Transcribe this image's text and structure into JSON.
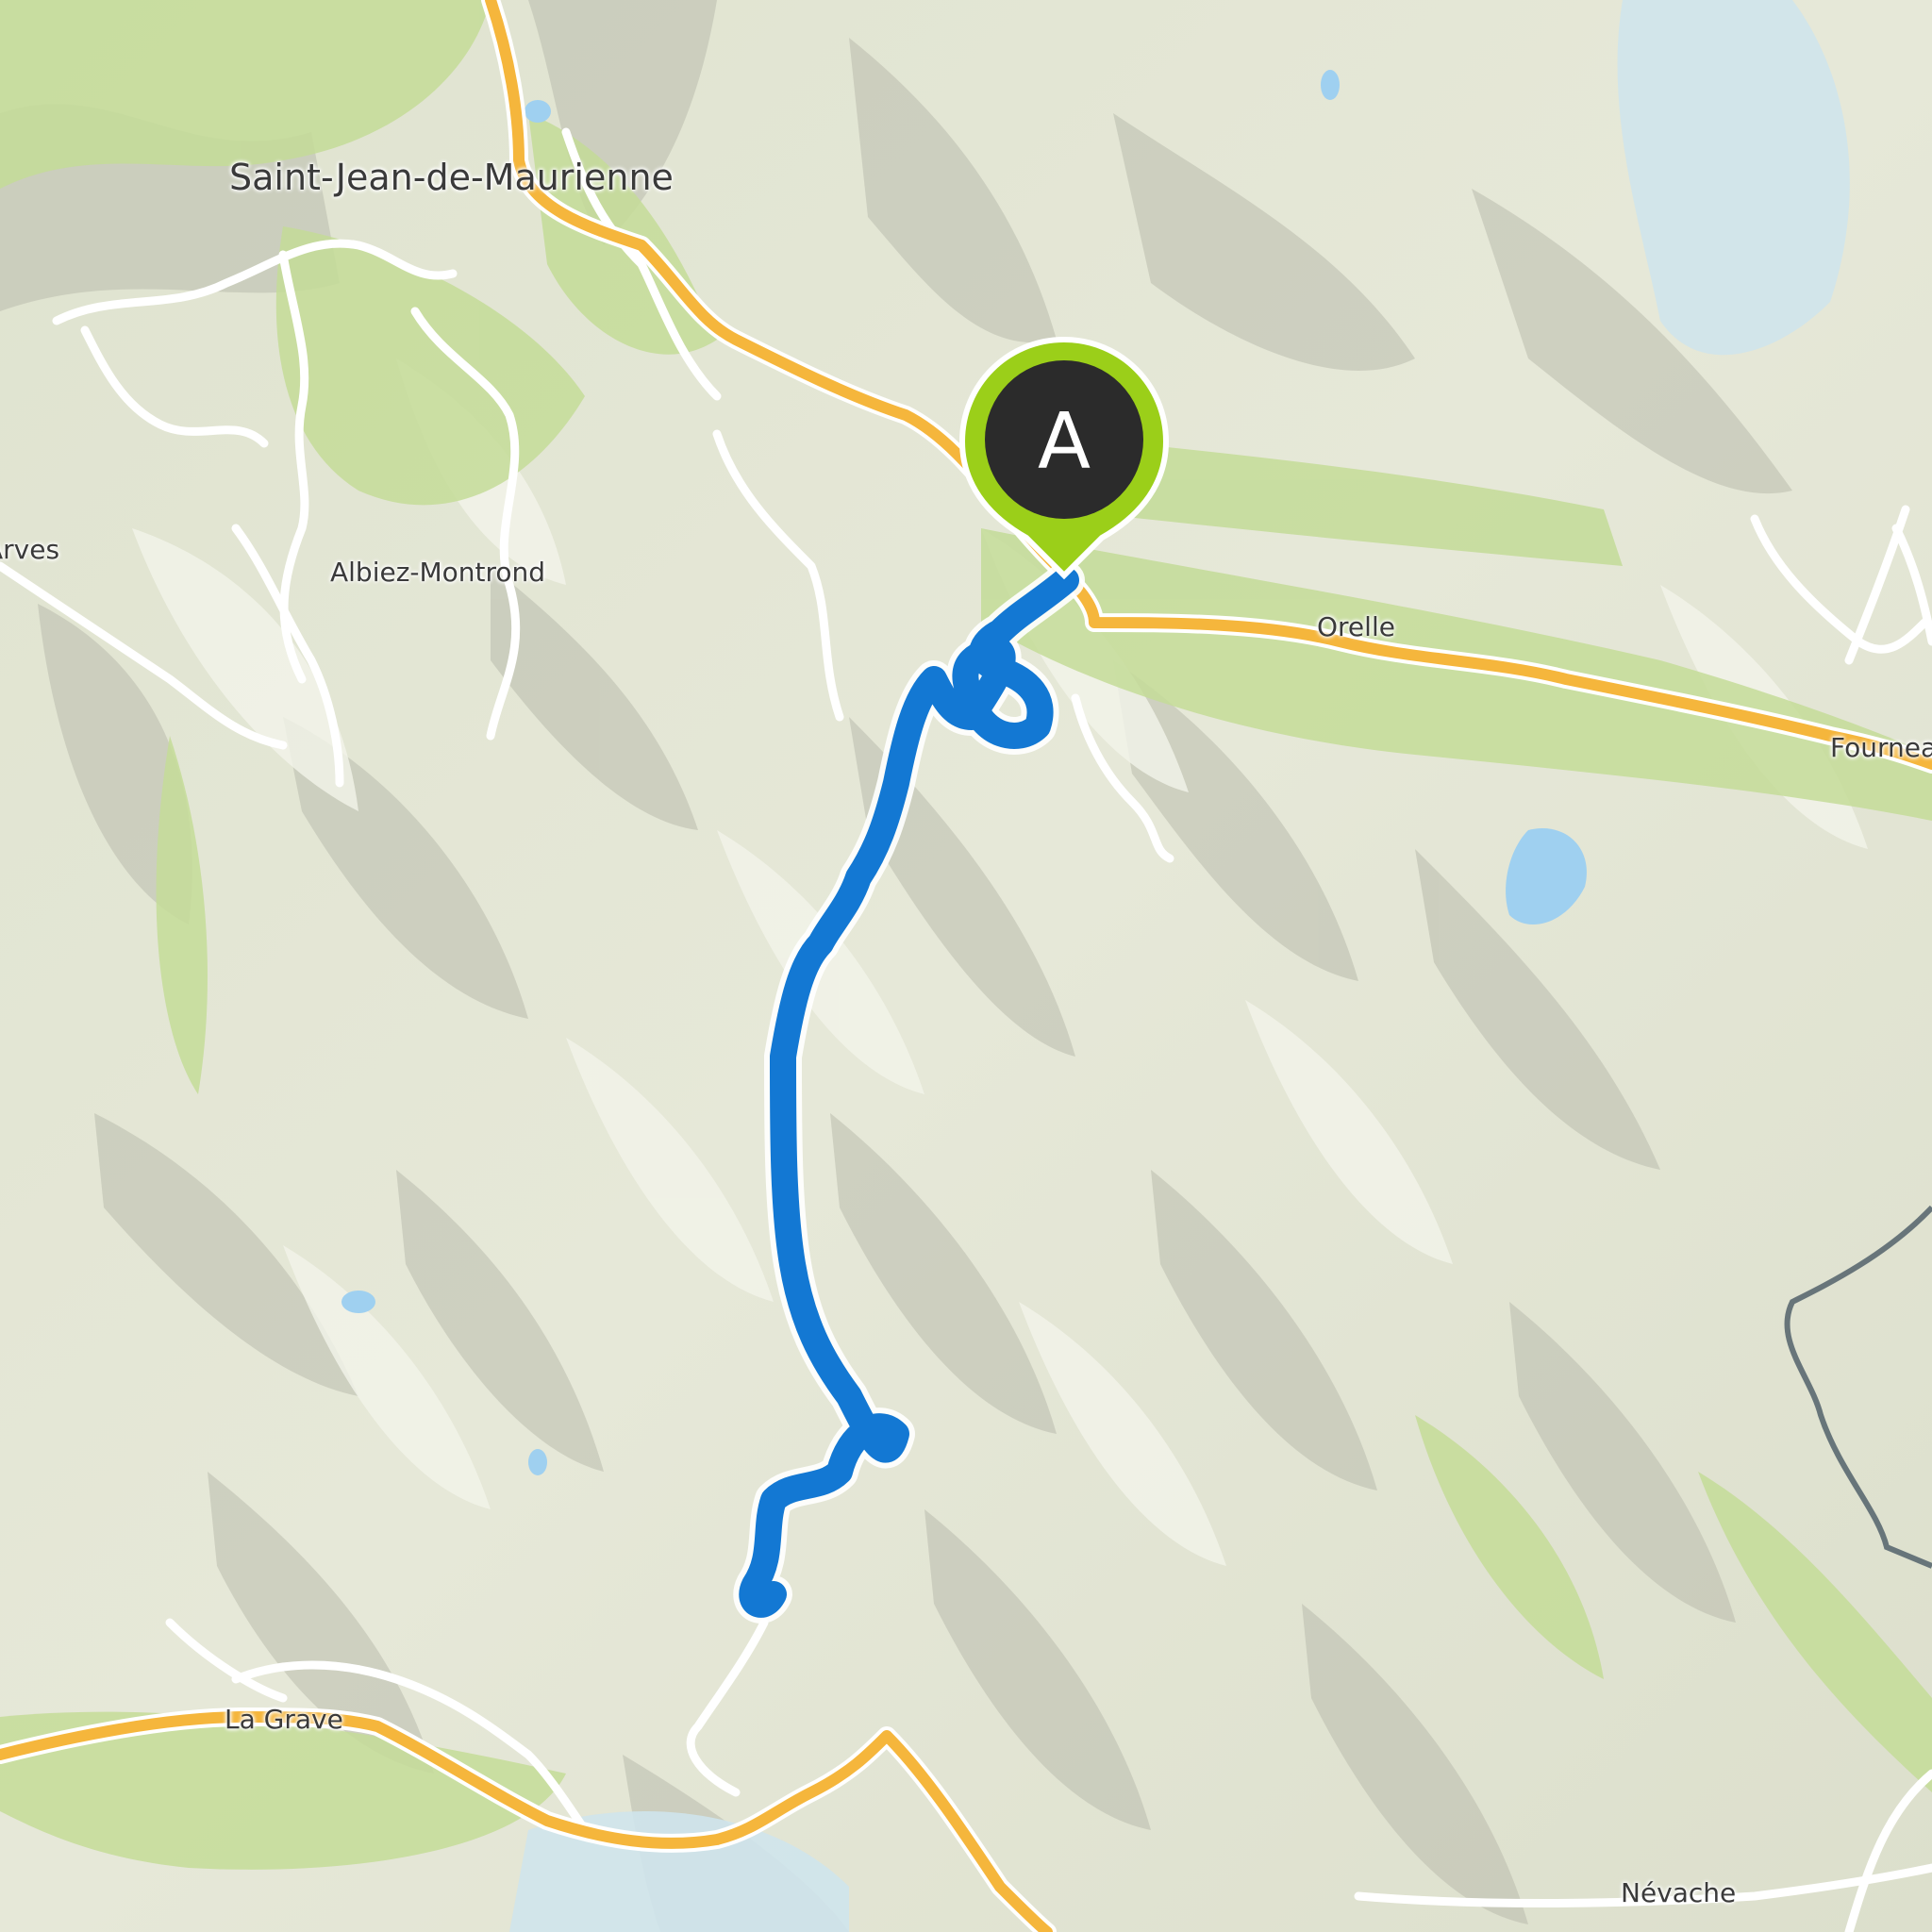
{
  "map": {
    "type": "topographic route map",
    "colors": {
      "route": "#1378d3",
      "main_road": "#f5b63c",
      "minor_road": "#ffffff",
      "border": "#52616b",
      "marker_fill": "#9bcf19",
      "marker_badge": "#2b2b2b",
      "water": "#9fd0f0",
      "forest": "#c4dc98"
    }
  },
  "marker": {
    "label": "A",
    "icon": "map-pin-icon"
  },
  "places": {
    "saint_jean": "Saint-Jean-de-Maurienne",
    "albiez": "Albiez-Montrond",
    "arves": "Arves",
    "orelle": "Orelle",
    "fourneaux": "Fourneaux",
    "la_grave": "La Grave",
    "nevache": "Névache"
  }
}
